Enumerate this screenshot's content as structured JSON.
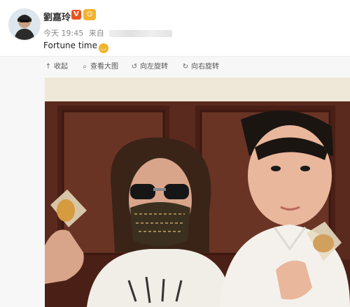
{
  "post": {
    "username": "劉嘉玲",
    "verified_badge": "V",
    "time": "今天 19:45",
    "source_prefix": "来自",
    "text": "Fortune time"
  },
  "toolbar": {
    "collapse": "收起",
    "view_large": "查看大图",
    "rotate_left": "向左旋转",
    "rotate_right": "向右旋转"
  },
  "icons": {
    "collapse": "arrow-up-icon",
    "view_large": "magnifier-icon",
    "rotate_left": "rotate-left-icon",
    "rotate_right": "rotate-right-icon"
  },
  "colors": {
    "verified": "#e8541e",
    "badge": "#f3b12e",
    "toolbar_bg": "#f7f7f7"
  }
}
